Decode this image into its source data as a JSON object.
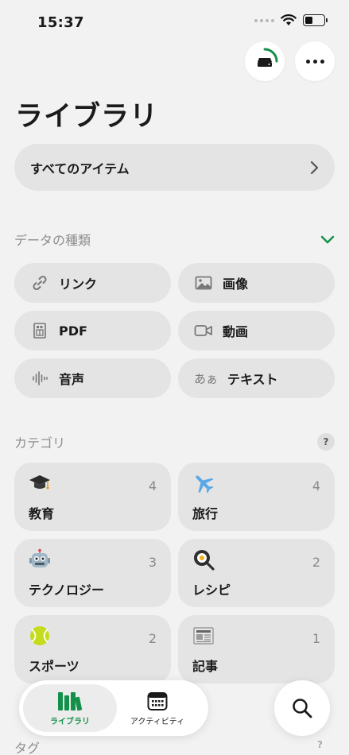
{
  "status_bar": {
    "time": "15:37"
  },
  "page_title": "ライブラリ",
  "all_items": {
    "label": "すべてのアイテム"
  },
  "data_types": {
    "label": "データの種類",
    "items": [
      {
        "label": "リンク",
        "icon": "link-icon"
      },
      {
        "label": "画像",
        "icon": "image-icon"
      },
      {
        "label": "PDF",
        "icon": "pdf-icon"
      },
      {
        "label": "動画",
        "icon": "video-icon"
      },
      {
        "label": "音声",
        "icon": "audio-wave-icon"
      },
      {
        "label": "テキスト",
        "icon": "text-icon",
        "glyph": "あぁ"
      }
    ]
  },
  "categories": {
    "label": "カテゴリ",
    "help": "?",
    "items": [
      {
        "label": "教育",
        "count": "4",
        "icon": "graduation-cap-icon"
      },
      {
        "label": "旅行",
        "count": "4",
        "icon": "airplane-icon"
      },
      {
        "label": "テクノロジー",
        "count": "3",
        "icon": "robot-icon"
      },
      {
        "label": "レシピ",
        "count": "2",
        "icon": "frying-pan-icon"
      },
      {
        "label": "スポーツ",
        "count": "2",
        "icon": "tennis-ball-icon"
      },
      {
        "label": "記事",
        "count": "1",
        "icon": "newspaper-icon"
      }
    ]
  },
  "tags": {
    "label": "タグ",
    "help": "?"
  },
  "tab_bar": {
    "tabs": [
      {
        "label": "ライブラリ",
        "icon": "library-books-icon",
        "active": true
      },
      {
        "label": "アクティビティ",
        "icon": "calendar-icon",
        "active": false
      }
    ]
  },
  "colors": {
    "accent": "#13914a",
    "background": "#f2f2f2",
    "card": "#e4e4e4"
  }
}
